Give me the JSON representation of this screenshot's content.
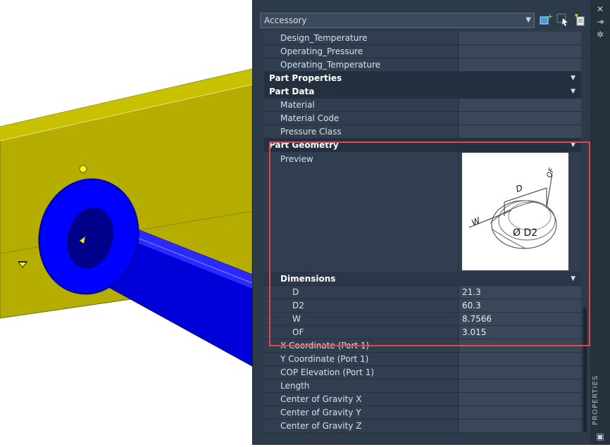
{
  "viewport": {
    "colors": {
      "background": "#ffffff",
      "pipe": "#b8b200",
      "fitting": "#0000ff",
      "grip": "#ffff00"
    }
  },
  "palette": {
    "dropdown_value": "Accessory",
    "side_label": "PROPERTIES",
    "rows_top": [
      {
        "name": "Design_Temperature",
        "value": ""
      },
      {
        "name": "Operating_Pressure",
        "value": ""
      },
      {
        "name": "Operating_Temperature",
        "value": ""
      }
    ],
    "categories": {
      "part_properties": "Part Properties",
      "part_data": "Part Data",
      "part_geometry": "Part Geometry",
      "dimensions": "Dimensions"
    },
    "part_data_rows": [
      {
        "name": "Material",
        "value": ""
      },
      {
        "name": "Material Code",
        "value": ""
      },
      {
        "name": "Pressure Class",
        "value": ""
      }
    ],
    "preview_label": "Preview",
    "preview_labels": {
      "w": "W",
      "d": "D",
      "of": "OF",
      "d2": "Ø D2"
    },
    "dimensions": [
      {
        "name": "D",
        "value": "21.3"
      },
      {
        "name": "D2",
        "value": "60.3"
      },
      {
        "name": "W",
        "value": "8.7566"
      },
      {
        "name": "OF",
        "value": "3.015"
      }
    ],
    "rows_bottom": [
      {
        "name": "X Coordinate (Port 1)",
        "value": ""
      },
      {
        "name": "Y Coordinate (Port 1)",
        "value": ""
      },
      {
        "name": "COP Elevation (Port 1)",
        "value": ""
      },
      {
        "name": "Length",
        "value": ""
      },
      {
        "name": "Center of Gravity X",
        "value": ""
      },
      {
        "name": "Center of Gravity Y",
        "value": ""
      },
      {
        "name": "Center of Gravity Z",
        "value": ""
      }
    ],
    "colors": {
      "highlight": "#e0484c",
      "panel": "#2d3a4a"
    }
  }
}
